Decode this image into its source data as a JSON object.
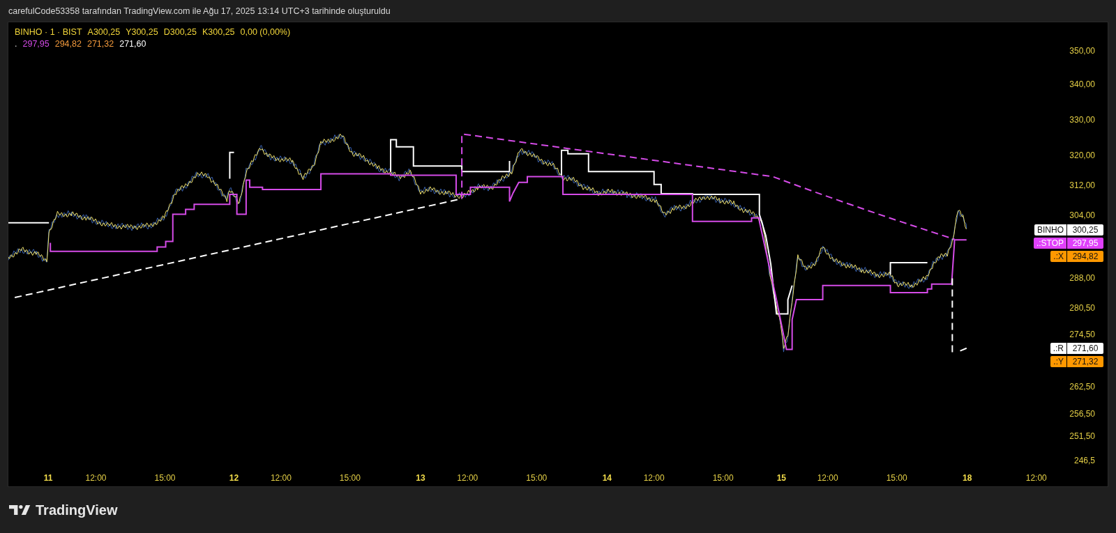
{
  "header": {
    "caption": "carefulCode53358 tarafından TradingView.com ile Ağu 17, 2025 13:14 UTC+3 tarihinde oluşturuldu"
  },
  "chart": {
    "legend": {
      "symbol": "BINHO · 1 · BIST",
      "ohlc": [
        "A300,25",
        "Y300,25",
        "D300,25",
        "K300,25",
        "0,00 (0,00%)"
      ],
      "indicator_dot": ".",
      "indicator_values": [
        {
          "text": "297,95",
          "color": "#d54be8"
        },
        {
          "text": "294,82",
          "color": "#f39a3c"
        },
        {
          "text": "271,32",
          "color": "#f39a3c"
        },
        {
          "text": "271,60",
          "color": "#ffffff"
        }
      ]
    },
    "price_axis": {
      "ticks": [
        "350,00",
        "340,00",
        "330,00",
        "320,00",
        "312,00",
        "304,00",
        "288,00",
        "280,50",
        "274,50",
        "262,50",
        "256,50",
        "251,50",
        "246,5"
      ]
    },
    "price_labels": [
      {
        "name": "BINHO",
        "value": "300,25",
        "color": "#ffffff"
      },
      {
        "name": ".:STOP",
        "value": "297,95",
        "color": "#e040fb"
      },
      {
        "name": ".:X",
        "value": "294,82",
        "color": "#ff9800"
      },
      {
        "name": ".:R",
        "value": "271,60",
        "color": "#ffffff"
      },
      {
        "name": ".:Y",
        "value": "271,32",
        "color": "#ff9800"
      }
    ],
    "time_axis": {
      "ticks": [
        {
          "label": "11",
          "kind": "day"
        },
        {
          "label": "12:00",
          "kind": "time"
        },
        {
          "label": "15:00",
          "kind": "time"
        },
        {
          "label": "12",
          "kind": "day"
        },
        {
          "label": "12:00",
          "kind": "time"
        },
        {
          "label": "15:00",
          "kind": "time"
        },
        {
          "label": "13",
          "kind": "day"
        },
        {
          "label": "12:00",
          "kind": "time"
        },
        {
          "label": "15:00",
          "kind": "time"
        },
        {
          "label": "14",
          "kind": "day"
        },
        {
          "label": "12:00",
          "kind": "time"
        },
        {
          "label": "15:00",
          "kind": "time"
        },
        {
          "label": "15",
          "kind": "day"
        },
        {
          "label": "12:00",
          "kind": "time"
        },
        {
          "label": "15:00",
          "kind": "time"
        },
        {
          "label": "18",
          "kind": "day"
        },
        {
          "label": "12:00",
          "kind": "time"
        }
      ]
    }
  },
  "footer": {
    "logo_text": "TradingView"
  }
}
